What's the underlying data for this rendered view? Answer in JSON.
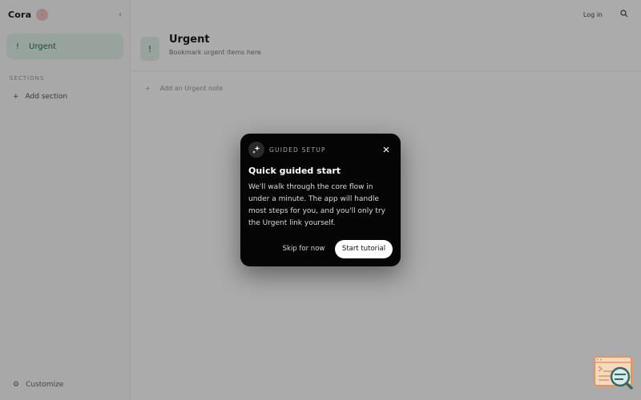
{
  "app": {
    "brand": "Cora",
    "brand_badge": "·",
    "sidebar_toggle": "‹",
    "sidebar_active_item": "Urgent",
    "sidebar_section": "SECTIONS",
    "sidebar_add": "Add section",
    "sidebar_footer": "Customize",
    "topbar_login": "Log in",
    "channel_title": "Urgent",
    "channel_subtitle": "Bookmark urgent items here",
    "channel_input_placeholder": "Add an Urgent note",
    "empty_title": "",
    "empty_lines": [
      "",
      ""
    ]
  },
  "modal": {
    "eyebrow": "GUIDED SETUP",
    "title": "Quick guided start",
    "body": "We'll walk through the core flow in under a minute. The app will handle most steps for you, and you'll only try the Urgent link yourself.",
    "skip_label": "Skip for now",
    "start_label": "Start tutorial"
  },
  "icons": {
    "badge": "sparkles-icon",
    "close": "close-icon",
    "helper": "help-widget-icon"
  },
  "colors": {
    "overlay": "rgba(0,0,0,0.33)",
    "modal_bg": "#050505",
    "accent_green": "#e3f3ec",
    "helper_orange": "#e8935a",
    "helper_teal": "#2e6b6b"
  }
}
